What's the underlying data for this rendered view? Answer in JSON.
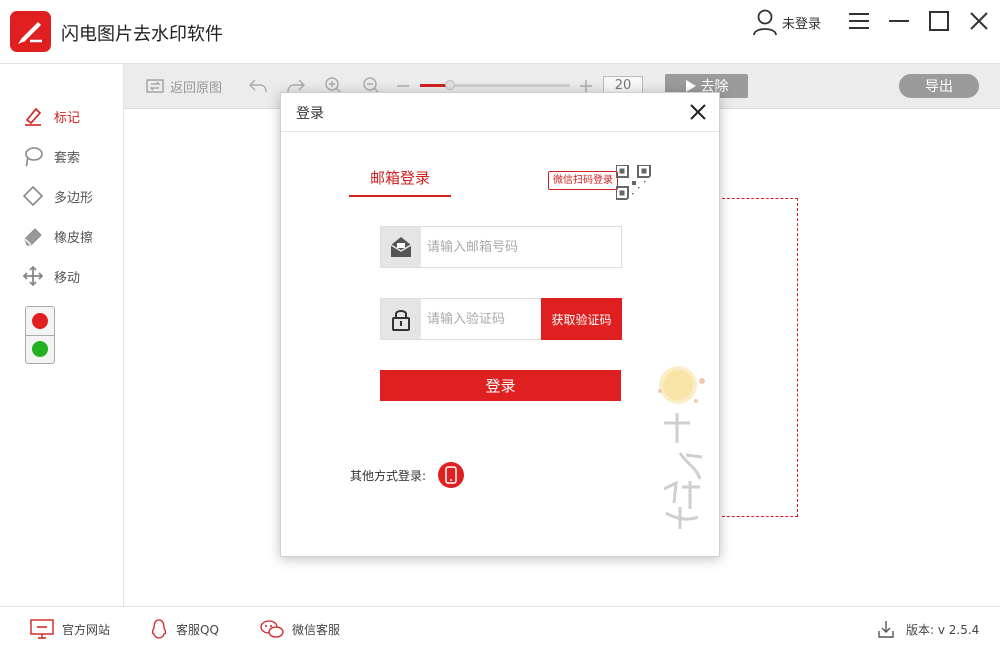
{
  "app": {
    "title": "闪电图片去水印软件",
    "user_label": "未登录"
  },
  "tools": [
    {
      "label": "标记",
      "icon": "marker-icon",
      "active": true
    },
    {
      "label": "套索",
      "icon": "lasso-icon",
      "active": false
    },
    {
      "label": "多边形",
      "icon": "polygon-icon",
      "active": false
    },
    {
      "label": "橡皮擦",
      "icon": "eraser-icon",
      "active": false
    },
    {
      "label": "移动",
      "icon": "move-icon",
      "active": false
    }
  ],
  "colors": {
    "first": "#e02020",
    "second": "#20b020",
    "accent": "#e02020"
  },
  "toolbar": {
    "restore_label": "返回原图",
    "zoom_value": "20",
    "zoom_level": 0.2,
    "remove_label": "去除",
    "export_label": "导出"
  },
  "modal": {
    "title": "登录",
    "tab_email": "邮箱登录",
    "qr_tip": "微信扫码登录",
    "email_placeholder": "请输入邮箱号码",
    "code_placeholder": "请输入验证码",
    "get_code_label": "获取验证码",
    "login_label": "登录",
    "other_login_label": "其他方式登录:",
    "deco_text": "中秋快乐"
  },
  "statusbar": {
    "website_label": "官方网站",
    "qq_label": "客服QQ",
    "wechat_label": "微信客服",
    "version_label": "版本: v 2.5.4"
  }
}
